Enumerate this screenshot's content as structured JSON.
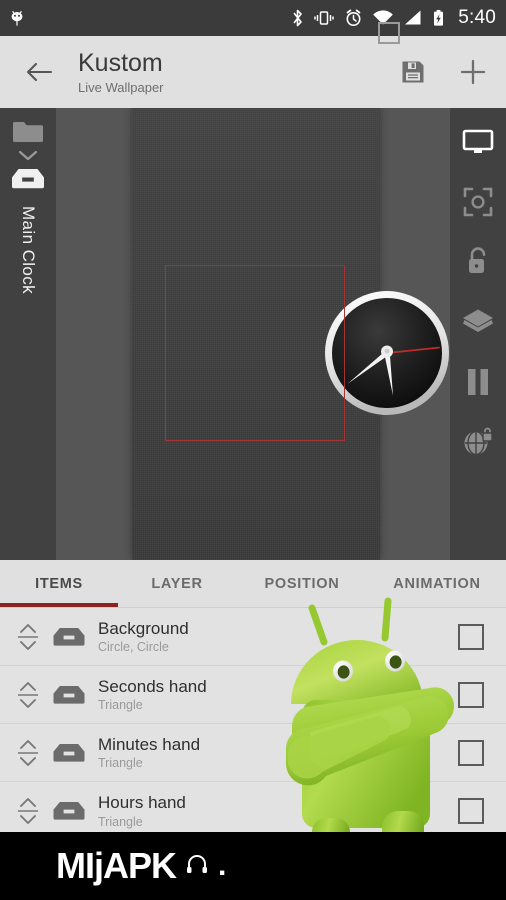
{
  "status_bar": {
    "notification_icon": "android-head-icon",
    "icons": [
      "bluetooth-icon",
      "vibrate-icon",
      "alarm-icon",
      "wifi-icon",
      "signal-icon",
      "battery-charging-icon"
    ],
    "time": "5:40",
    "background_color": "#3b3b3b"
  },
  "toolbar": {
    "back_icon": "arrow-back-icon",
    "title": "Kustom",
    "subtitle": "Live Wallpaper",
    "save_icon": "save-floppy-icon",
    "add_icon": "plus-icon",
    "background_color": "#e0e0e0"
  },
  "left_rail": {
    "folder_icon": "folder-icon",
    "chevron_icon": "chevron-down-icon",
    "tray_icon": "inbox-tray-icon",
    "label": "Main Clock",
    "background_color": "#414141"
  },
  "right_rail": {
    "items": [
      {
        "icon": "monitor-preview-icon",
        "active": true
      },
      {
        "icon": "focus-crop-icon",
        "active": false
      },
      {
        "icon": "unlock-icon",
        "active": false
      },
      {
        "icon": "layers-icon",
        "active": false
      },
      {
        "icon": "pause-icon",
        "active": false
      },
      {
        "icon": "globe-lock-icon",
        "active": false
      }
    ]
  },
  "preview": {
    "selection_color": "#a33434",
    "wallpaper_color": "#3e3e3e",
    "backdrop_color": "#565656",
    "clock": {
      "face_color": "#1b1b1b",
      "ring_color": "#efefef",
      "second_hand_color": "#c22a2a",
      "hour_angle_deg": 172,
      "minute_angle_deg": 232,
      "second_angle_deg": 84
    }
  },
  "tabs": [
    {
      "label": "ITEMS",
      "active": true
    },
    {
      "label": "LAYER",
      "active": false
    },
    {
      "label": "POSITION",
      "active": false
    },
    {
      "label": "ANIMATION",
      "active": false
    }
  ],
  "tab_indicator_color": "#8e2222",
  "items": [
    {
      "handle_icon": "reorder-handle-icon",
      "type_icon": "inbox-tray-icon",
      "title": "Background",
      "subtitle": "Circle, Circle",
      "checked": false
    },
    {
      "handle_icon": "reorder-handle-icon",
      "type_icon": "inbox-tray-icon",
      "title": "Seconds hand",
      "subtitle": "Triangle",
      "checked": false
    },
    {
      "handle_icon": "reorder-handle-icon",
      "type_icon": "inbox-tray-icon",
      "title": "Minutes hand",
      "subtitle": "Triangle",
      "checked": false
    },
    {
      "handle_icon": "reorder-handle-icon",
      "type_icon": "inbox-tray-icon",
      "title": "Hours hand",
      "subtitle": "Triangle",
      "checked": false
    }
  ],
  "overlay": {
    "mascot_icon": "android-mascot-image",
    "mascot_color": "#9dcf3a"
  },
  "nav_bar": {
    "watermark_text": "MIjAPK",
    "watermark_suffix_icon": "headset-icon",
    "watermark_dot": ".",
    "recents_icon": "recents-square-icon",
    "background_color": "#000000"
  }
}
